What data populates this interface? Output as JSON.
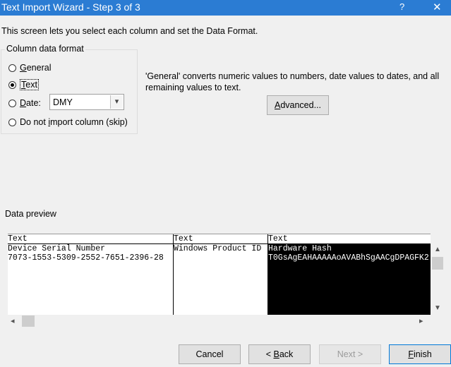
{
  "window": {
    "title": "Text Import Wizard - Step 3 of 3",
    "help_glyph": "?",
    "close_glyph": "✕"
  },
  "description": "This screen lets you select each column and set the Data Format.",
  "column_format": {
    "group_title": "Column data format",
    "options": [
      {
        "label": "General",
        "checked": false
      },
      {
        "label": "Text",
        "checked": true
      },
      {
        "label": "Date:",
        "checked": false
      },
      {
        "label": "Do not import column (skip)",
        "checked": false
      }
    ],
    "date_value": "DMY"
  },
  "info_text": "'General' converts numeric values to numbers, date values to dates, and all remaining values to text.",
  "advanced_button": "Advanced...",
  "preview": {
    "label": "Data preview",
    "columns": [
      {
        "header": "Text",
        "cells": [
          "Device Serial Number",
          "7073-1553-5309-2552-7651-2396-28"
        ]
      },
      {
        "header": "Text",
        "cells": [
          "Windows Product ID",
          ""
        ]
      },
      {
        "header": "Text",
        "cells": [
          "Hardware Hash",
          "T0GsAgEAHAAAAAoAVABhSgAACgDPAGFK2"
        ]
      }
    ]
  },
  "buttons": {
    "cancel": "Cancel",
    "back": "< Back",
    "next": "Next >",
    "finish": "Finish"
  },
  "icons": {
    "dropdown": "chevron-down-icon",
    "scroll_up": "chevron-up-icon",
    "scroll_down": "chevron-down-icon",
    "scroll_left": "chevron-left-icon",
    "scroll_right": "chevron-right-icon"
  },
  "colors": {
    "titlebar": "#2b7cd3",
    "selected_column": "#000000",
    "default_button_border": "#0078d7"
  }
}
